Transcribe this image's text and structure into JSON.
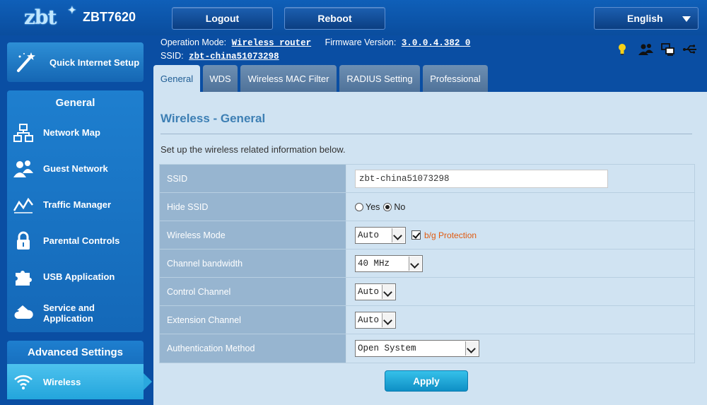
{
  "header": {
    "logo": "zbt",
    "model": "ZBT7620",
    "logout_label": "Logout",
    "reboot_label": "Reboot",
    "language": "English"
  },
  "info": {
    "mode_label": "Operation Mode:",
    "mode_value": "Wireless router",
    "fw_label": "Firmware Version:",
    "fw_value": "3.0.0.4.382_0",
    "ssid_label": "SSID:",
    "ssid_value": "zbt-china51073298"
  },
  "status_icons": [
    "light-bulb-icon",
    "users-icon",
    "network-icon",
    "usb-icon"
  ],
  "sidebar": {
    "quick_setup": "Quick Internet Setup",
    "general_title": "General",
    "general_items": [
      {
        "label": "Network Map",
        "icon": "network-map-icon"
      },
      {
        "label": "Guest Network",
        "icon": "guest-network-icon"
      },
      {
        "label": "Traffic Manager",
        "icon": "traffic-manager-icon"
      },
      {
        "label": "Parental Controls",
        "icon": "lock-icon"
      },
      {
        "label": "USB Application",
        "icon": "puzzle-icon"
      },
      {
        "label": "Service and Application",
        "icon": "cloud-icon"
      }
    ],
    "advanced_title": "Advanced Settings",
    "active_item": "Wireless"
  },
  "tabs": [
    "General",
    "WDS",
    "Wireless MAC Filter",
    "RADIUS Setting",
    "Professional"
  ],
  "page": {
    "title": "Wireless - General",
    "description": "Set up the wireless related information below.",
    "rows": {
      "ssid": {
        "label": "SSID",
        "value": "zbt-china51073298"
      },
      "hide_ssid": {
        "label": "Hide SSID",
        "yes": "Yes",
        "no": "No"
      },
      "wireless_mode": {
        "label": "Wireless Mode",
        "value": "Auto",
        "protection": "b/g Protection"
      },
      "bandwidth": {
        "label": "Channel bandwidth",
        "value": "40 MHz"
      },
      "control_channel": {
        "label": "Control Channel",
        "value": "Auto"
      },
      "extension_channel": {
        "label": "Extension Channel",
        "value": "Auto"
      },
      "auth": {
        "label": "Authentication Method",
        "value": "Open System"
      }
    },
    "apply_label": "Apply"
  },
  "colors": {
    "header_bg": "#0a4ea3",
    "content_bg": "#d0e3f2",
    "accent": "#3d7fb4",
    "active_nav": "#2aa8de",
    "warning_text": "#e05a10"
  }
}
